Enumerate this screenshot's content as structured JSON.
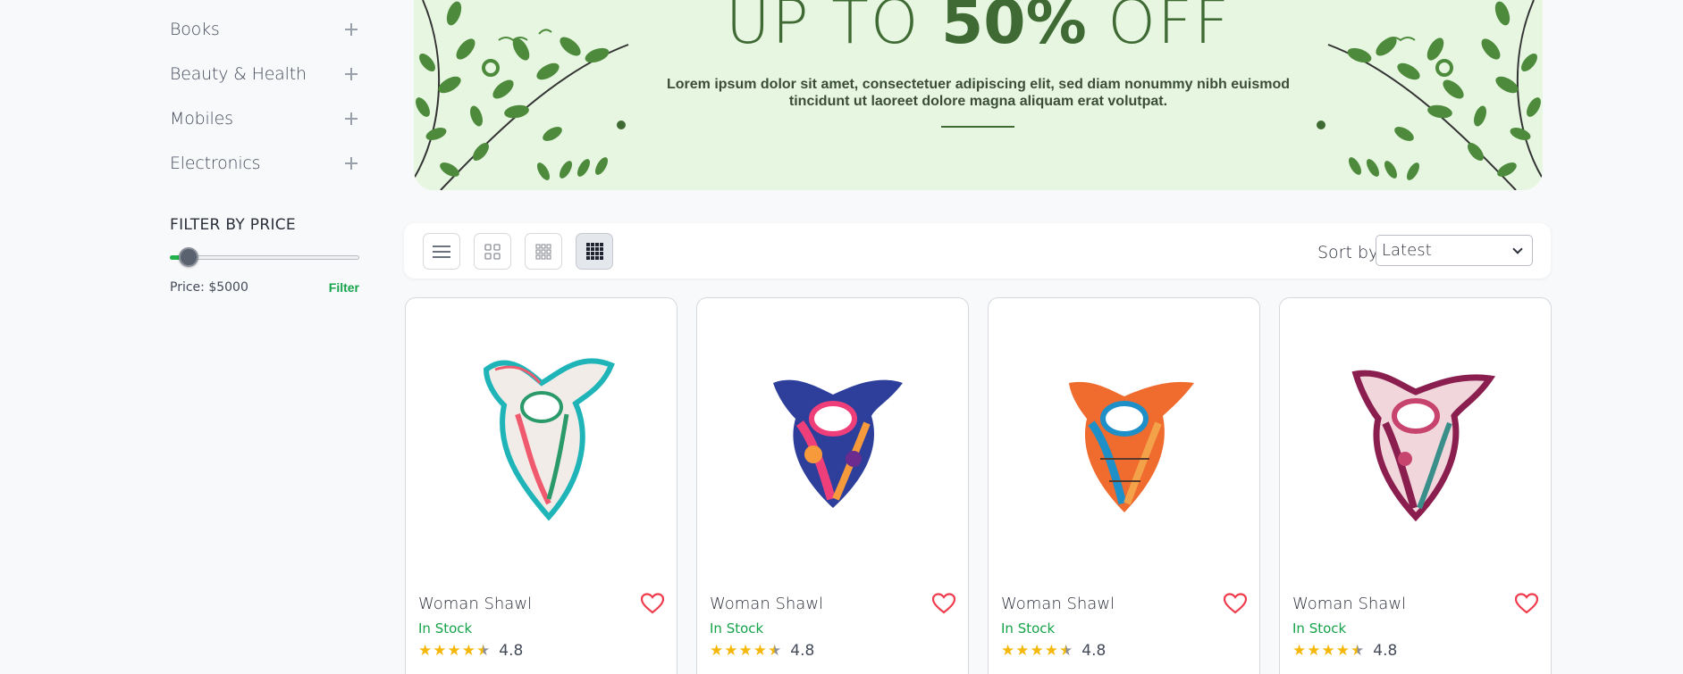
{
  "sidebar": {
    "categories": [
      {
        "label": "Books"
      },
      {
        "label": "Beauty & Health"
      },
      {
        "label": "Mobiles"
      },
      {
        "label": "Electronics"
      }
    ],
    "filter": {
      "title": "FILTER BY PRICE",
      "price_text": "Price: $5000",
      "button_label": "Filter",
      "slider_level": 0.02
    }
  },
  "banner": {
    "title_prefix": "UP TO ",
    "title_bold": "50%",
    "title_suffix": " OFF",
    "subtitle": "Lorem ipsum dolor sit amet, consectetuer adipiscing elit, sed diam nonummy nibh euismod tincidunt ut laoreet dolore magna aliquam erat volutpat."
  },
  "toolbar": {
    "views": [
      {
        "icon": "list-view-icon",
        "active": false
      },
      {
        "icon": "grid-2-icon",
        "active": false
      },
      {
        "icon": "grid-3-icon",
        "active": false
      },
      {
        "icon": "grid-4-icon",
        "active": true
      }
    ],
    "sort_label": "Sort by",
    "sort_value": "Latest"
  },
  "products": [
    {
      "name": "Woman Shawl",
      "stock": "In Stock",
      "rating": "4.8",
      "colors": [
        "#f2ece8",
        "#1fb5b8",
        "#ef5a6f",
        "#2a9a6a"
      ]
    },
    {
      "name": "Woman Shawl",
      "stock": "In Stock",
      "rating": "4.8",
      "colors": [
        "#2d3f9a",
        "#ee3f7a",
        "#f79a3c",
        "#6b2b8f"
      ]
    },
    {
      "name": "Woman Shawl",
      "stock": "In Stock",
      "rating": "4.8",
      "colors": [
        "#f06b2e",
        "#1f8fc7",
        "#f4a24a",
        "#5a3a2a"
      ]
    },
    {
      "name": "Woman Shawl",
      "stock": "In Stock",
      "rating": "4.8",
      "colors": [
        "#f1d6dc",
        "#8a1f4f",
        "#3b8f8a",
        "#c7446f"
      ]
    }
  ],
  "colors": {
    "accent_green": "#16a34a",
    "banner_bg": "#e6f6e1",
    "heart": "#ef3b4b",
    "star": "#f5b80a"
  }
}
